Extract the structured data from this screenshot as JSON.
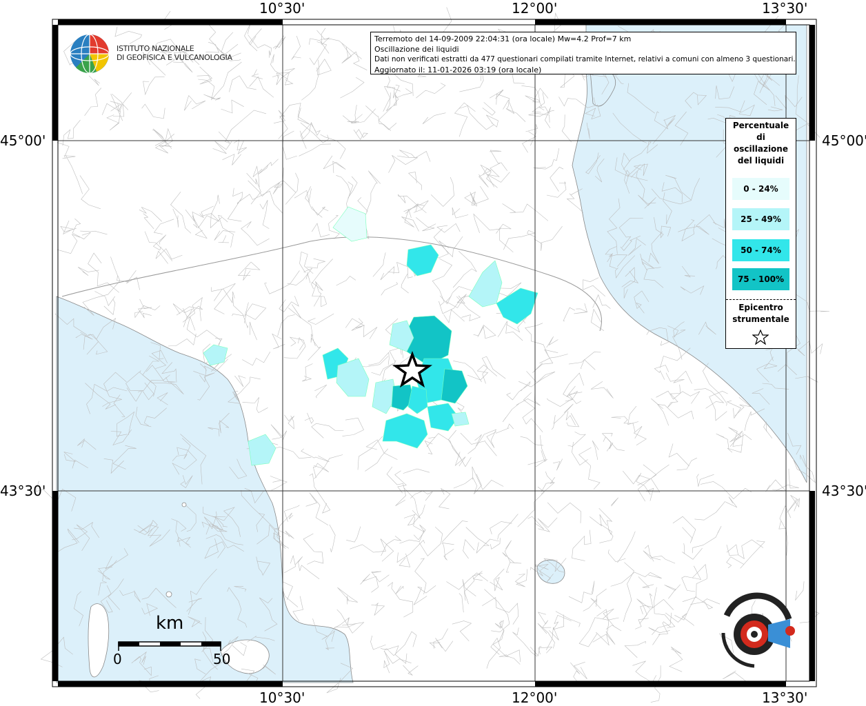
{
  "info": {
    "line1": "Terremoto del 14-09-2009 22:04:31 (ora locale) Mw=4.2 Prof=7 km",
    "line2": "Oscillazione dei liquidi",
    "line3": "Dati non verificati estratti da 477 questionari compilati tramite Internet, relativi a comuni con almeno 3 questionari.",
    "line4": "Aggiornato il: 11-01-2026 03:19 (ora locale)"
  },
  "logo": {
    "line1": "ISTITUTO NAZIONALE",
    "line2": "DI GEOFISICA E VULCANOLOGIA"
  },
  "axes": {
    "lon_top": [
      "10°30'",
      "12°00'",
      "13°30'"
    ],
    "lon_bottom": [
      "10°30'",
      "12°00'",
      "13°30'"
    ],
    "lat_left": [
      "45°00'",
      "43°30'"
    ],
    "lat_right": [
      "45°00'",
      "43°30'"
    ]
  },
  "legend": {
    "title": "Percentuale di oscillazione del liquidi",
    "classes": [
      {
        "label": "0 - 24%",
        "color": "#e6fcfc"
      },
      {
        "label": "25 - 49%",
        "color": "#b4f5f8"
      },
      {
        "label": "50 - 74%",
        "color": "#32e6ea"
      },
      {
        "label": "75 - 100%",
        "color": "#12c4c6"
      }
    ],
    "epicentre_label": "Epicentro strumentale",
    "epicentre_icon": "star-icon"
  },
  "scale": {
    "unit": "km",
    "start": "0",
    "end": "50"
  },
  "colors": {
    "sea": "#dcf0fa",
    "land": "#ffffff",
    "borders": "#bbbbbb",
    "grid": "#333333"
  }
}
